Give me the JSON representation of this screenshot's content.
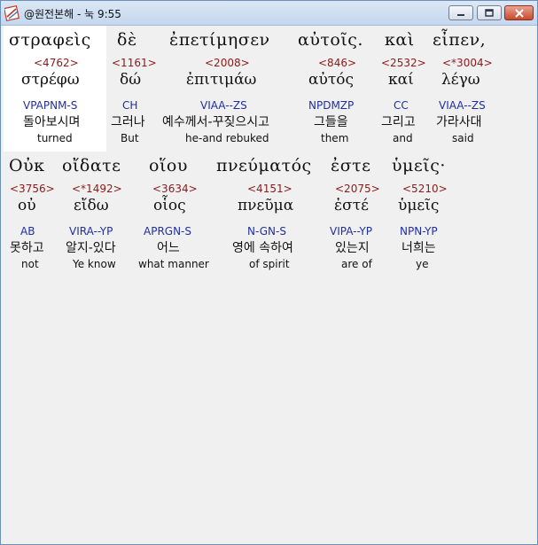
{
  "window": {
    "title": "@원전본해 - 눅 9:55"
  },
  "rows": [
    {
      "words": [
        {
          "greek": "στραφεὶς",
          "strong": "<4762>",
          "lemma": "στρέφω",
          "parse": "VPAPNM-S",
          "korean": "돌아보시며",
          "english": "turned"
        },
        {
          "greek": "δὲ",
          "strong": "<1161>",
          "lemma": "δώ",
          "parse": "CH",
          "korean": "그러나",
          "english": "But"
        },
        {
          "greek": "ἐπετίμησεν",
          "strong": "<2008>",
          "lemma": "ἐπιτιμάω",
          "parse": "VIAA--ZS",
          "korean": "예수께서-꾸짖으시고",
          "english": "he-and rebuked"
        },
        {
          "greek": "αὐτοῖς.",
          "strong": "<846>",
          "lemma": "αὐτός",
          "parse": "NPDMZP",
          "korean": "그들을",
          "english": "them"
        },
        {
          "greek": "καὶ",
          "strong": "<2532>",
          "lemma": "καί",
          "parse": "CC",
          "korean": "그리고",
          "english": "and"
        },
        {
          "greek": "εἶπεν,",
          "strong": "<*3004>",
          "lemma": "λέγω",
          "parse": "VIAA--ZS",
          "korean": "가라사대",
          "english": "said"
        }
      ]
    },
    {
      "words": [
        {
          "greek": "Οὐκ",
          "strong": "<3756>",
          "lemma": "οὐ",
          "parse": "AB",
          "korean": "못하고",
          "english": "not"
        },
        {
          "greek": "οἴδατε",
          "strong": "<*1492>",
          "lemma": "εἴδω",
          "parse": "VIRA--YP",
          "korean": "알지-있다",
          "english": "Ye know"
        },
        {
          "greek": "οἵου",
          "strong": "<3634>",
          "lemma": "οἷος",
          "parse": "APRGN-S",
          "korean": "어느",
          "english": "what manner"
        },
        {
          "greek": "πνεύματός",
          "strong": "<4151>",
          "lemma": "πνεῦμα",
          "parse": "N-GN-S",
          "korean": "영에 속하여",
          "english": "of spirit"
        },
        {
          "greek": "ἐστε",
          "strong": "<2075>",
          "lemma": "ἐστέ",
          "parse": "VIPA--YP",
          "korean": "있는지",
          "english": "are of"
        },
        {
          "greek": "ὑμεῖς·",
          "strong": "<5210>",
          "lemma": "ὑμεῖς",
          "parse": "NPN-YP",
          "korean": "너희는",
          "english": "ye"
        }
      ]
    }
  ]
}
